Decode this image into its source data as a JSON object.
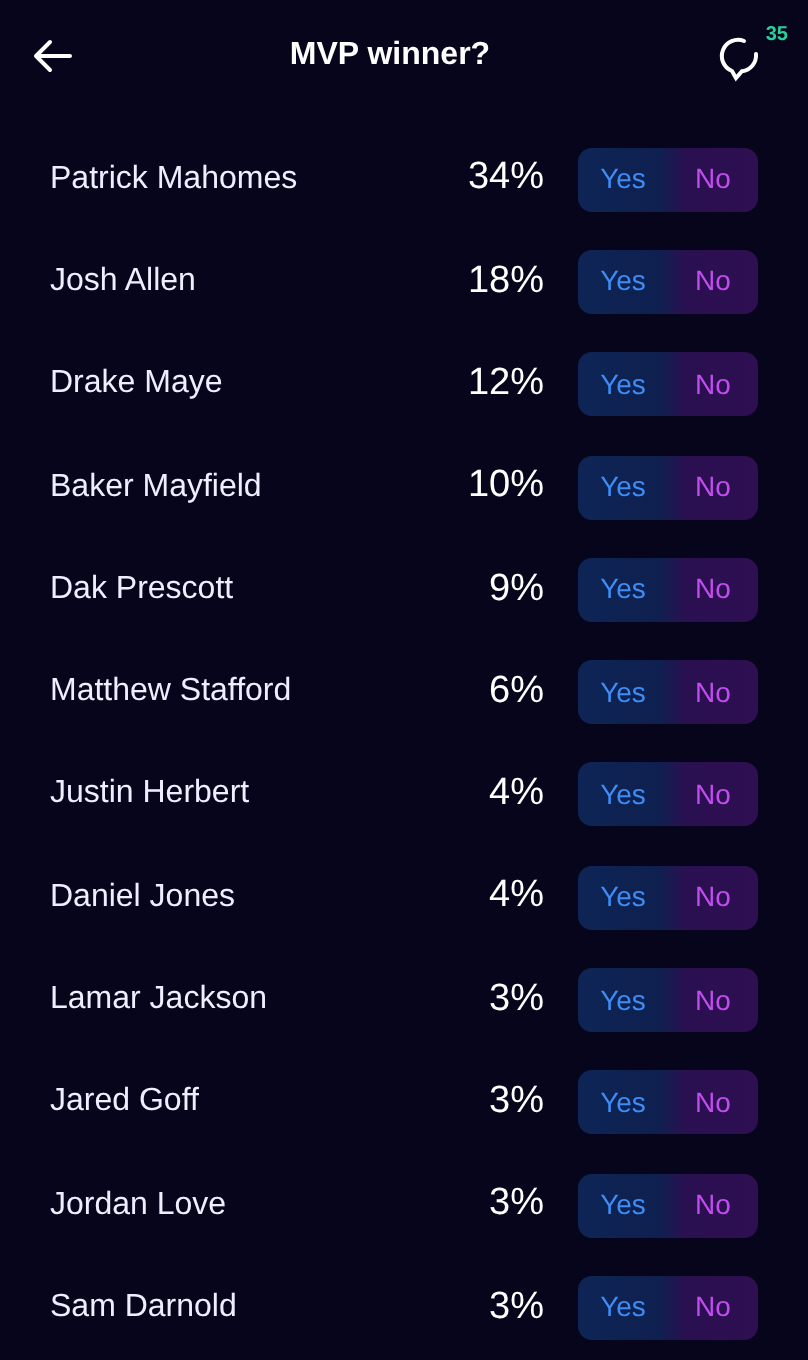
{
  "header": {
    "title": "MVP winner?",
    "comment_count": "35"
  },
  "options": [
    {
      "name": "Patrick Mahomes",
      "percent": "34%",
      "yes": "Yes",
      "no": "No"
    },
    {
      "name": "Josh Allen",
      "percent": "18%",
      "yes": "Yes",
      "no": "No"
    },
    {
      "name": "Drake Maye",
      "percent": "12%",
      "yes": "Yes",
      "no": "No"
    },
    {
      "name": "Baker Mayfield",
      "percent": "10%",
      "yes": "Yes",
      "no": "No"
    },
    {
      "name": "Dak Prescott",
      "percent": "9%",
      "yes": "Yes",
      "no": "No"
    },
    {
      "name": "Matthew Stafford",
      "percent": "6%",
      "yes": "Yes",
      "no": "No"
    },
    {
      "name": "Justin Herbert",
      "percent": "4%",
      "yes": "Yes",
      "no": "No"
    },
    {
      "name": "Daniel Jones",
      "percent": "4%",
      "yes": "Yes",
      "no": "No"
    },
    {
      "name": "Lamar Jackson",
      "percent": "3%",
      "yes": "Yes",
      "no": "No"
    },
    {
      "name": "Jared Goff",
      "percent": "3%",
      "yes": "Yes",
      "no": "No"
    },
    {
      "name": "Jordan Love",
      "percent": "3%",
      "yes": "Yes",
      "no": "No"
    },
    {
      "name": "Sam Darnold",
      "percent": "3%",
      "yes": "Yes",
      "no": "No"
    }
  ]
}
